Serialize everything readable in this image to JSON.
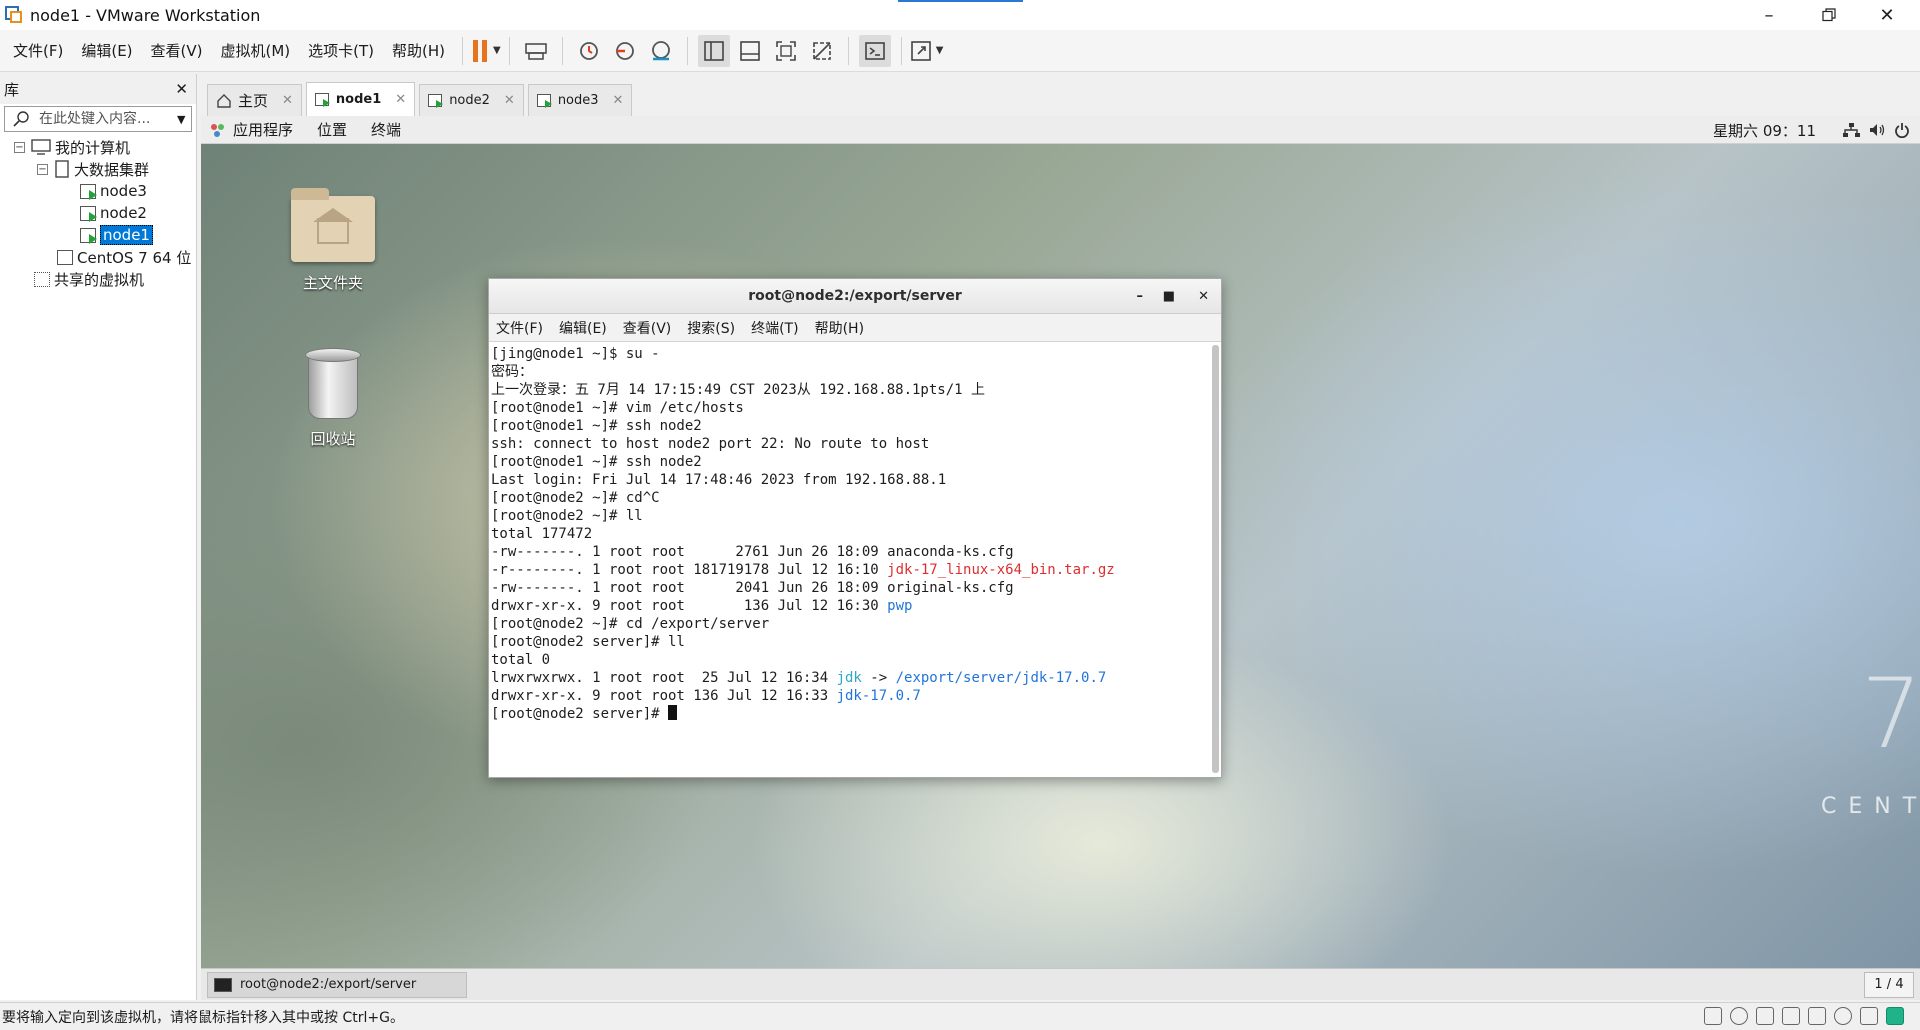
{
  "window": {
    "title": "node1 - VMware Workstation"
  },
  "menu": [
    "文件(F)",
    "编辑(E)",
    "查看(V)",
    "虚拟机(M)",
    "选项卡(T)",
    "帮助(H)"
  ],
  "library": {
    "title": "库",
    "search_placeholder": "在此处键入内容...",
    "tree": {
      "root": "我的计算机",
      "group": "大数据集群",
      "vms": [
        "node3",
        "node2",
        "node1"
      ],
      "selected": "node1",
      "other_vm": "CentOS 7 64 位",
      "shared": "共享的虚拟机"
    }
  },
  "tabs": [
    {
      "label": "主页",
      "icon": "home-icon"
    },
    {
      "label": "node1",
      "icon": "vm-icon",
      "active": true
    },
    {
      "label": "node2",
      "icon": "vm-icon"
    },
    {
      "label": "node3",
      "icon": "vm-icon"
    }
  ],
  "guest_panel": {
    "menus": [
      "应用程序",
      "位置",
      "终端"
    ],
    "clock": "星期六 09：11"
  },
  "desktop": {
    "icons": [
      "主文件夹",
      "回收站"
    ],
    "brand_number": "7",
    "brand_text": "CENTOS"
  },
  "terminal": {
    "title": "root@node2:/export/server",
    "menu": [
      "文件(F)",
      "编辑(E)",
      "查看(V)",
      "搜索(S)",
      "终端(T)",
      "帮助(H)"
    ],
    "lines": [
      "[jing@node1 ~]$ su -",
      "密码：",
      "上一次登录：五 7月 14 17:15:49 CST 2023从 192.168.88.1pts/1 上",
      "[root@node1 ~]# vim /etc/hosts",
      "[root@node1 ~]# ssh node2",
      "ssh: connect to host node2 port 22: No route to host",
      "[root@node1 ~]# ssh node2",
      "Last login: Fri Jul 14 17:48:46 2023 from 192.168.88.1",
      "[root@node2 ~]# cd^C",
      "[root@node2 ~]# ll",
      "total 177472"
    ],
    "ls1": [
      {
        "meta": "-rw-------. 1 root root      2761 Jun 26 18:09 ",
        "name": "anaconda-ks.cfg",
        "color": ""
      },
      {
        "meta": "-r--------. 1 root root 181719178 Jul 12 16:10 ",
        "name": "jdk-17_linux-x64_bin.tar.gz",
        "color": "red"
      },
      {
        "meta": "-rw-------. 1 root root      2041 Jun 26 18:09 ",
        "name": "original-ks.cfg",
        "color": ""
      },
      {
        "meta": "drwxr-xr-x. 9 root root       136 Jul 12 16:30 ",
        "name": "pwp",
        "color": "blue"
      }
    ],
    "lines2": [
      "[root@node2 ~]# cd /export/server",
      "[root@node2 server]# ll",
      "total 0"
    ],
    "link_line": {
      "meta": "lrwxrwxrwx. 1 root root  25 Jul 12 16:34 ",
      "name": "jdk",
      "arrow": " -> ",
      "target": "/export/server/jdk-17.0.7"
    },
    "dir_line": {
      "meta": "drwxr-xr-x. 9 root root 136 Jul 12 16:33 ",
      "name": "jdk-17.0.7"
    },
    "prompt": "[root@node2 server]# "
  },
  "taskbar": {
    "item": "root@node2:/export/server",
    "pager": "1 / 4"
  },
  "statusbar": {
    "message": "要将输入定向到该虚拟机，请将鼠标指针移入其中或按 Ctrl+G。"
  }
}
